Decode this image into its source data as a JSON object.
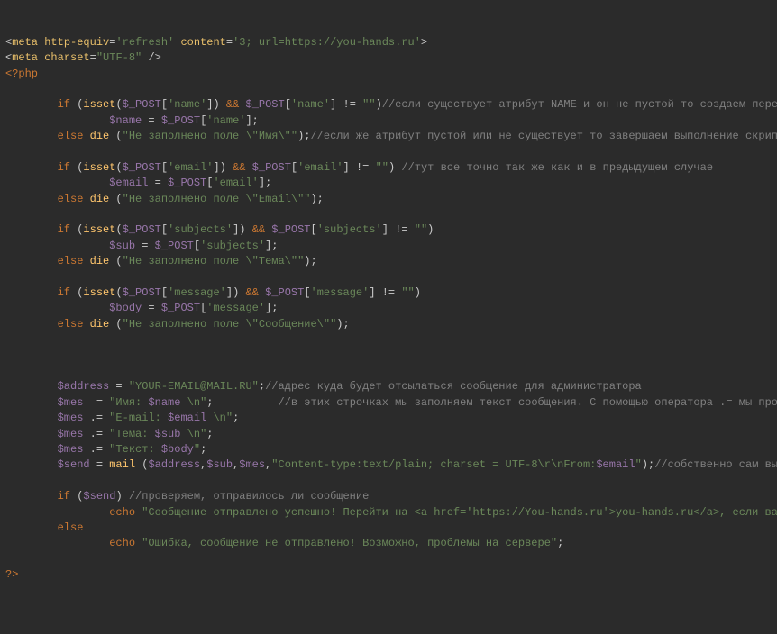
{
  "meta1": {
    "tag": "meta",
    "attr1": "http-equiv",
    "val1": "'refresh'",
    "attr2": "content",
    "val2": "'3; url=https://you-hands.ru'"
  },
  "meta2": {
    "tag": "meta",
    "attr1": "charset",
    "val1": "\"UTF-8\""
  },
  "phpOpen": "<?php",
  "phpClose": "?>",
  "k": {
    "if": "if",
    "else": "else",
    "isset": "isset",
    "die": "die",
    "echo": "echo",
    "mail": "mail"
  },
  "v": {
    "post": "$_POST",
    "name": "$name",
    "email": "$email",
    "sub": "$sub",
    "body": "$body",
    "address": "$address",
    "mes": "$mes",
    "send": "$send"
  },
  "idx": {
    "name": "'name'",
    "email": "'email'",
    "subjects": "'subjects'",
    "message": "'message'"
  },
  "str": {
    "empty": "\"\"",
    "dieName": "\"Не заполнено поле \\\"Имя\\\"\"",
    "dieEmail": "\"Не заполнено поле \\\"Email\\\"\"",
    "dieSub": "\"Не заполнено поле \\\"Тема\\\"\"",
    "dieMsg": "\"Не заполнено поле \\\"Сообщение\\\"\"",
    "addr": "\"YOUR-EMAIL@MAIL.RU\"",
    "mes1a": "\"Имя: ",
    "mes1b": " \\n\"",
    "mes2a": "\"E-mail: ",
    "mes2b": " \\n\"",
    "mes3a": "\"Тема: ",
    "mes3b": " \\n\"",
    "mes4a": "\"Текст: ",
    "mes4b": "\"",
    "hdr1": "\"Content-type:text/plain; charset = UTF-8\\r\\nFrom:",
    "hdr2": "\"",
    "ok1": "\"Сообщение отправлено успешно! Перейти на <a href='https://You-hands.ru'>you-hands.ru</a>, если вас не перенаправило вручную",
    "err": "\"Ошибка, сообщение не отправлено! Возможно, проблемы на сервере\""
  },
  "cm": {
    "name": "//если существует атрибут NAME и он не пустой то создаем переменную для отправки сообщени",
    "dieName": "//если же атрибут пустой или не существует то завершаем выполнение скрипта и выдаем ошибку пользова",
    "email": "//тут все точно так же как и в предыдущем случае",
    "addr": "//адрес куда будет отсылаться сообщение для администратора",
    "mes": "//в этих строчках мы заполняем текст сообщения. С помощью оператора .= мы просто дополняем текст в перемен",
    "send": "//собственно сам вызов функции отправки сообщ",
    "check": "//проверяем, отправилось ли сообщение"
  }
}
